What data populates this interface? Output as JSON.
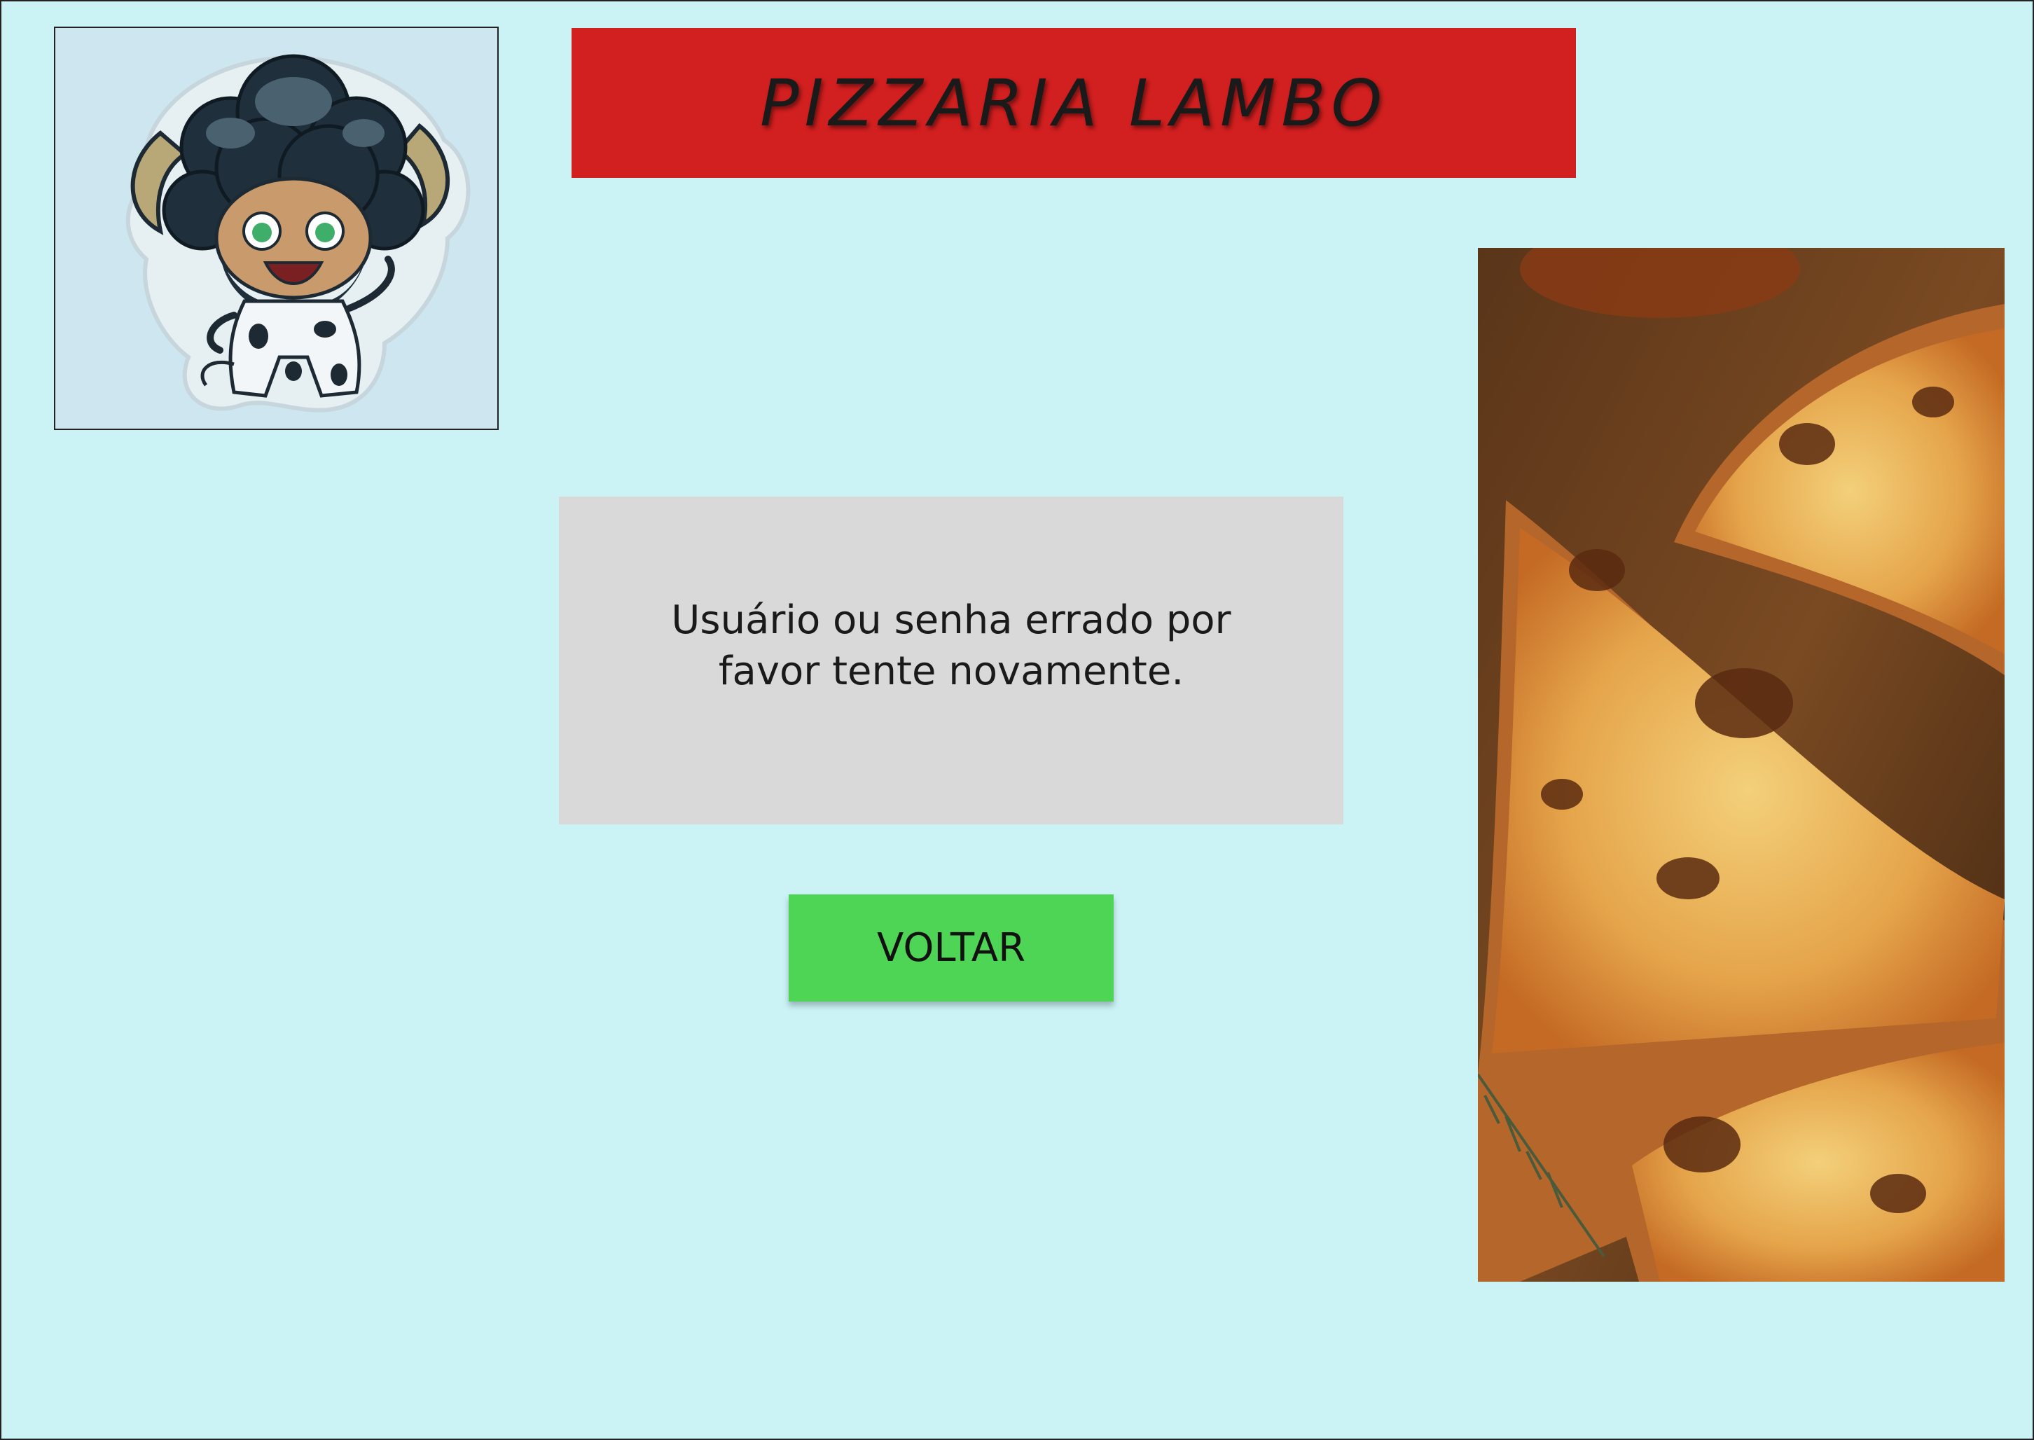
{
  "header": {
    "title": "PIZZARIA LAMBO"
  },
  "message": {
    "text": "Usuário ou senha errado por favor tente novamente."
  },
  "actions": {
    "back_label": "VOLTAR"
  },
  "images": {
    "logo": "cartoon-bull-mascot",
    "photo": "pizza-slices-photo"
  },
  "colors": {
    "background": "#cbf3f6",
    "title_bar": "#d21f1f",
    "message_box": "#d9d9d9",
    "button": "#4fd555"
  }
}
